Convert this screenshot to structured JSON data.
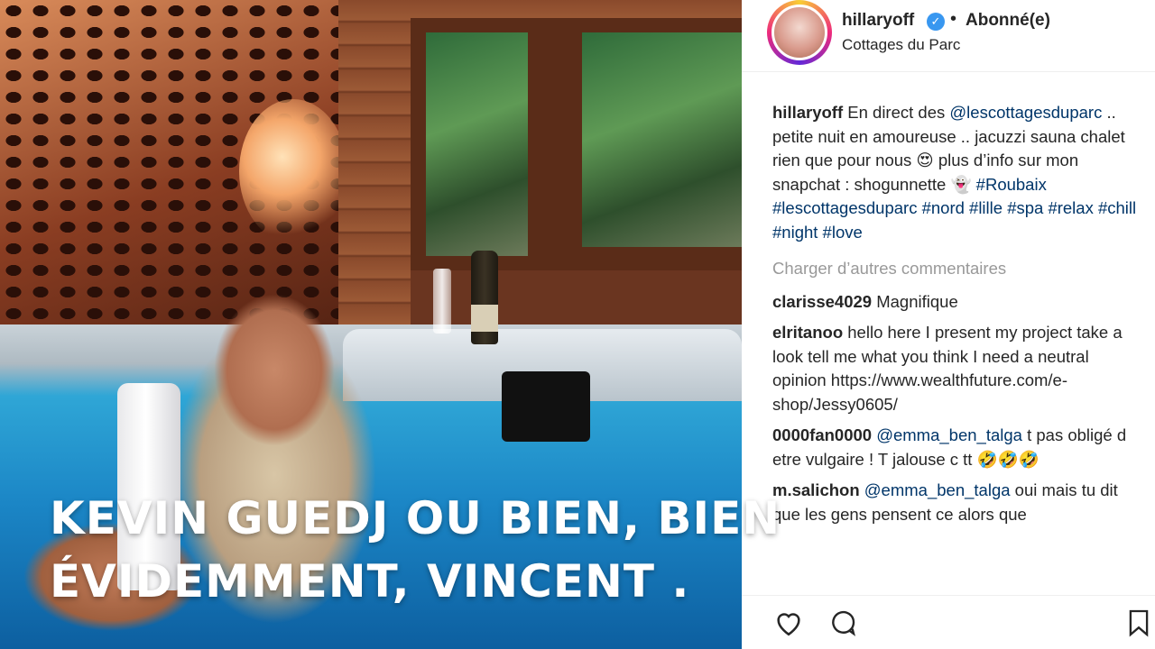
{
  "video": {
    "caption_lines": [
      "KEVIN GUEDJ OU BIEN, BIEN",
      "ÉVIDEMMENT, VINCENT ."
    ]
  },
  "post": {
    "username": "hillaryoff",
    "verified_icon": "verified-badge-icon",
    "separator": "•",
    "follow_status": "Abonné(e)",
    "location": "Cottages du Parc",
    "caption": {
      "username": "hillaryoff",
      "text_1": " En direct des ",
      "mention": "@lescottagesduparc",
      "text_2": " .. petite nuit en amoureuse .. jacuzzi sauna chalet rien que pour nous 😍 plus d’info sur mon snapchat : shogunnette 👻 ",
      "tags": "#Roubaix #lescottagesduparc #nord #lille #spa #relax #chill #night #love"
    },
    "load_more": "Charger d’autres commentaires",
    "comments": [
      {
        "user": "clarisse4029",
        "text": " Magnifique"
      },
      {
        "user": "elritanoo",
        "text": " hello here I present my project take a look tell me what you think I need a neutral opinion https://www.wealthfuture.com/e-shop/Jessy0605/"
      },
      {
        "user": "0000fan0000",
        "mention": "@emma_ben_talga",
        "text": " t pas obligé d etre vulgaire ! T jalouse c tt 🤣🤣🤣"
      },
      {
        "user": "m.salichon",
        "mention": "@emma_ben_talga",
        "text": " oui mais tu dit que les gens pensent ce alors que"
      }
    ]
  },
  "colors": {
    "link": "#003569",
    "muted": "#999999",
    "verified": "#3897f0"
  }
}
